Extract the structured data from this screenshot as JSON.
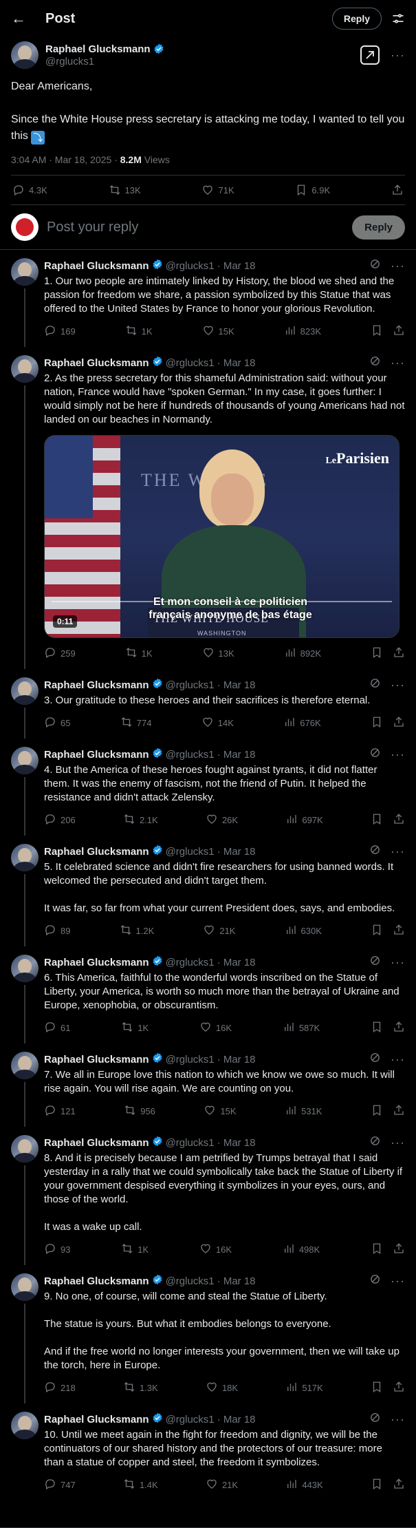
{
  "header": {
    "back_icon": "arrow-left-icon",
    "title": "Post",
    "reply_label": "Reply",
    "filter_icon": "sliders-icon"
  },
  "main_tweet": {
    "name": "Raphael Glucksmann",
    "handle": "@rglucks1",
    "text": "Dear Americans,\n\nSince the White House press secretary is attacking me today, I wanted to tell you this ",
    "emoji": "⤵",
    "timestamp": "3:04 AM · Mar 18, 2025 · ",
    "views_count": "8.2M",
    "views_label": " Views",
    "actions": {
      "replies": "4.3K",
      "reposts": "13K",
      "likes": "71K",
      "bookmarks": "6.9K"
    }
  },
  "reply_box": {
    "placeholder": "Post your reply",
    "button": "Reply"
  },
  "thread": [
    {
      "name": "Raphael Glucksmann",
      "handle": "@rglucks1",
      "date": "· Mar 18",
      "text": "1. Our two people are intimately linked by History, the blood we shed and the passion for freedom we share, a passion symbolized by this Statue that was offered to the United States by France to honor your glorious Revolution.",
      "replies": "169",
      "reposts": "1K",
      "likes": "15K",
      "views": "823K"
    },
    {
      "name": "Raphael Glucksmann",
      "handle": "@rglucks1",
      "date": "· Mar 18",
      "text": "2. As the press secretary for this shameful Administration said: without your nation, France would have \"spoken German.\" In my case, it goes further: I would simply not be here if hundreds of thousands of young Americans had not landed on our beaches in Normandy.",
      "replies": "259",
      "reposts": "1K",
      "likes": "13K",
      "views": "892K",
      "video": {
        "logo": "Le",
        "logo2": "Parisien",
        "subtitle": "Et mon conseil à ce politicien français anonyme de bas étage",
        "wall_text": "THE W      OUSE",
        "podium": "THE WHITE HOUSE",
        "podium_sub": "WASHINGTON",
        "time": "0:11"
      }
    },
    {
      "name": "Raphael Glucksmann",
      "handle": "@rglucks1",
      "date": "· Mar 18",
      "text": "3. Our gratitude to these heroes and their sacrifices is therefore eternal.",
      "replies": "65",
      "reposts": "774",
      "likes": "14K",
      "views": "676K"
    },
    {
      "name": "Raphael Glucksmann",
      "handle": "@rglucks1",
      "date": "· Mar 18",
      "text": "4. But the America of these heroes fought against tyrants, it did not flatter them. It was the enemy of fascism, not the friend of Putin. It helped the resistance and didn't attack Zelensky.",
      "replies": "206",
      "reposts": "2.1K",
      "likes": "26K",
      "views": "697K"
    },
    {
      "name": "Raphael Glucksmann",
      "handle": "@rglucks1",
      "date": "· Mar 18",
      "text": "5. It celebrated science and didn't fire researchers for using banned words. It welcomed the persecuted and didn't target them.\n\nIt was far, so far from what your current President does, says, and embodies.",
      "replies": "89",
      "reposts": "1.2K",
      "likes": "21K",
      "views": "630K"
    },
    {
      "name": "Raphael Glucksmann",
      "handle": "@rglucks1",
      "date": "· Mar 18",
      "text": "6. This America, faithful to the wonderful words inscribed on the Statue of Liberty, your America, is worth so much more than the betrayal of Ukraine and Europe, xenophobia, or obscurantism.",
      "replies": "61",
      "reposts": "1K",
      "likes": "16K",
      "views": "587K"
    },
    {
      "name": "Raphael Glucksmann",
      "handle": "@rglucks1",
      "date": "· Mar 18",
      "text": "7. We all in Europe love this nation to which we know we owe so much. It will rise again. You will rise again. We are counting on you.",
      "replies": "121",
      "reposts": "956",
      "likes": "15K",
      "views": "531K"
    },
    {
      "name": "Raphael Glucksmann",
      "handle": "@rglucks1",
      "date": "· Mar 18",
      "text": "8. And it is precisely because I am petrified by Trumps betrayal that I said yesterday in a rally that we could symbolically take back the Statue of Liberty if your government despised everything it symbolizes in your eyes, ours, and those of the world.\n\nIt was a wake up call.",
      "replies": "93",
      "reposts": "1K",
      "likes": "16K",
      "views": "498K"
    },
    {
      "name": "Raphael Glucksmann",
      "handle": "@rglucks1",
      "date": "· Mar 18",
      "text": "9. No one, of course, will come and steal the Statue of Liberty.\n\nThe statue is yours. But what it embodies belongs to everyone.\n\nAnd if the free world no longer interests your government, then we will take up the torch, here in Europe.",
      "replies": "218",
      "reposts": "1.3K",
      "likes": "18K",
      "views": "517K"
    },
    {
      "name": "Raphael Glucksmann",
      "handle": "@rglucks1",
      "date": "· Mar 18",
      "text": "10. Until we meet again in the fight for freedom and dignity, we will be the continuators of our shared history and the protectors of our treasure: more than a statue of copper and steel, the freedom it symbolizes.",
      "replies": "747",
      "reposts": "1.4K",
      "likes": "21K",
      "views": "443K"
    }
  ],
  "colors": {
    "background": "#000000",
    "text": "#e7e9ea",
    "muted": "#71767b",
    "border": "#2f3336",
    "verified": "#1d9bf0"
  }
}
